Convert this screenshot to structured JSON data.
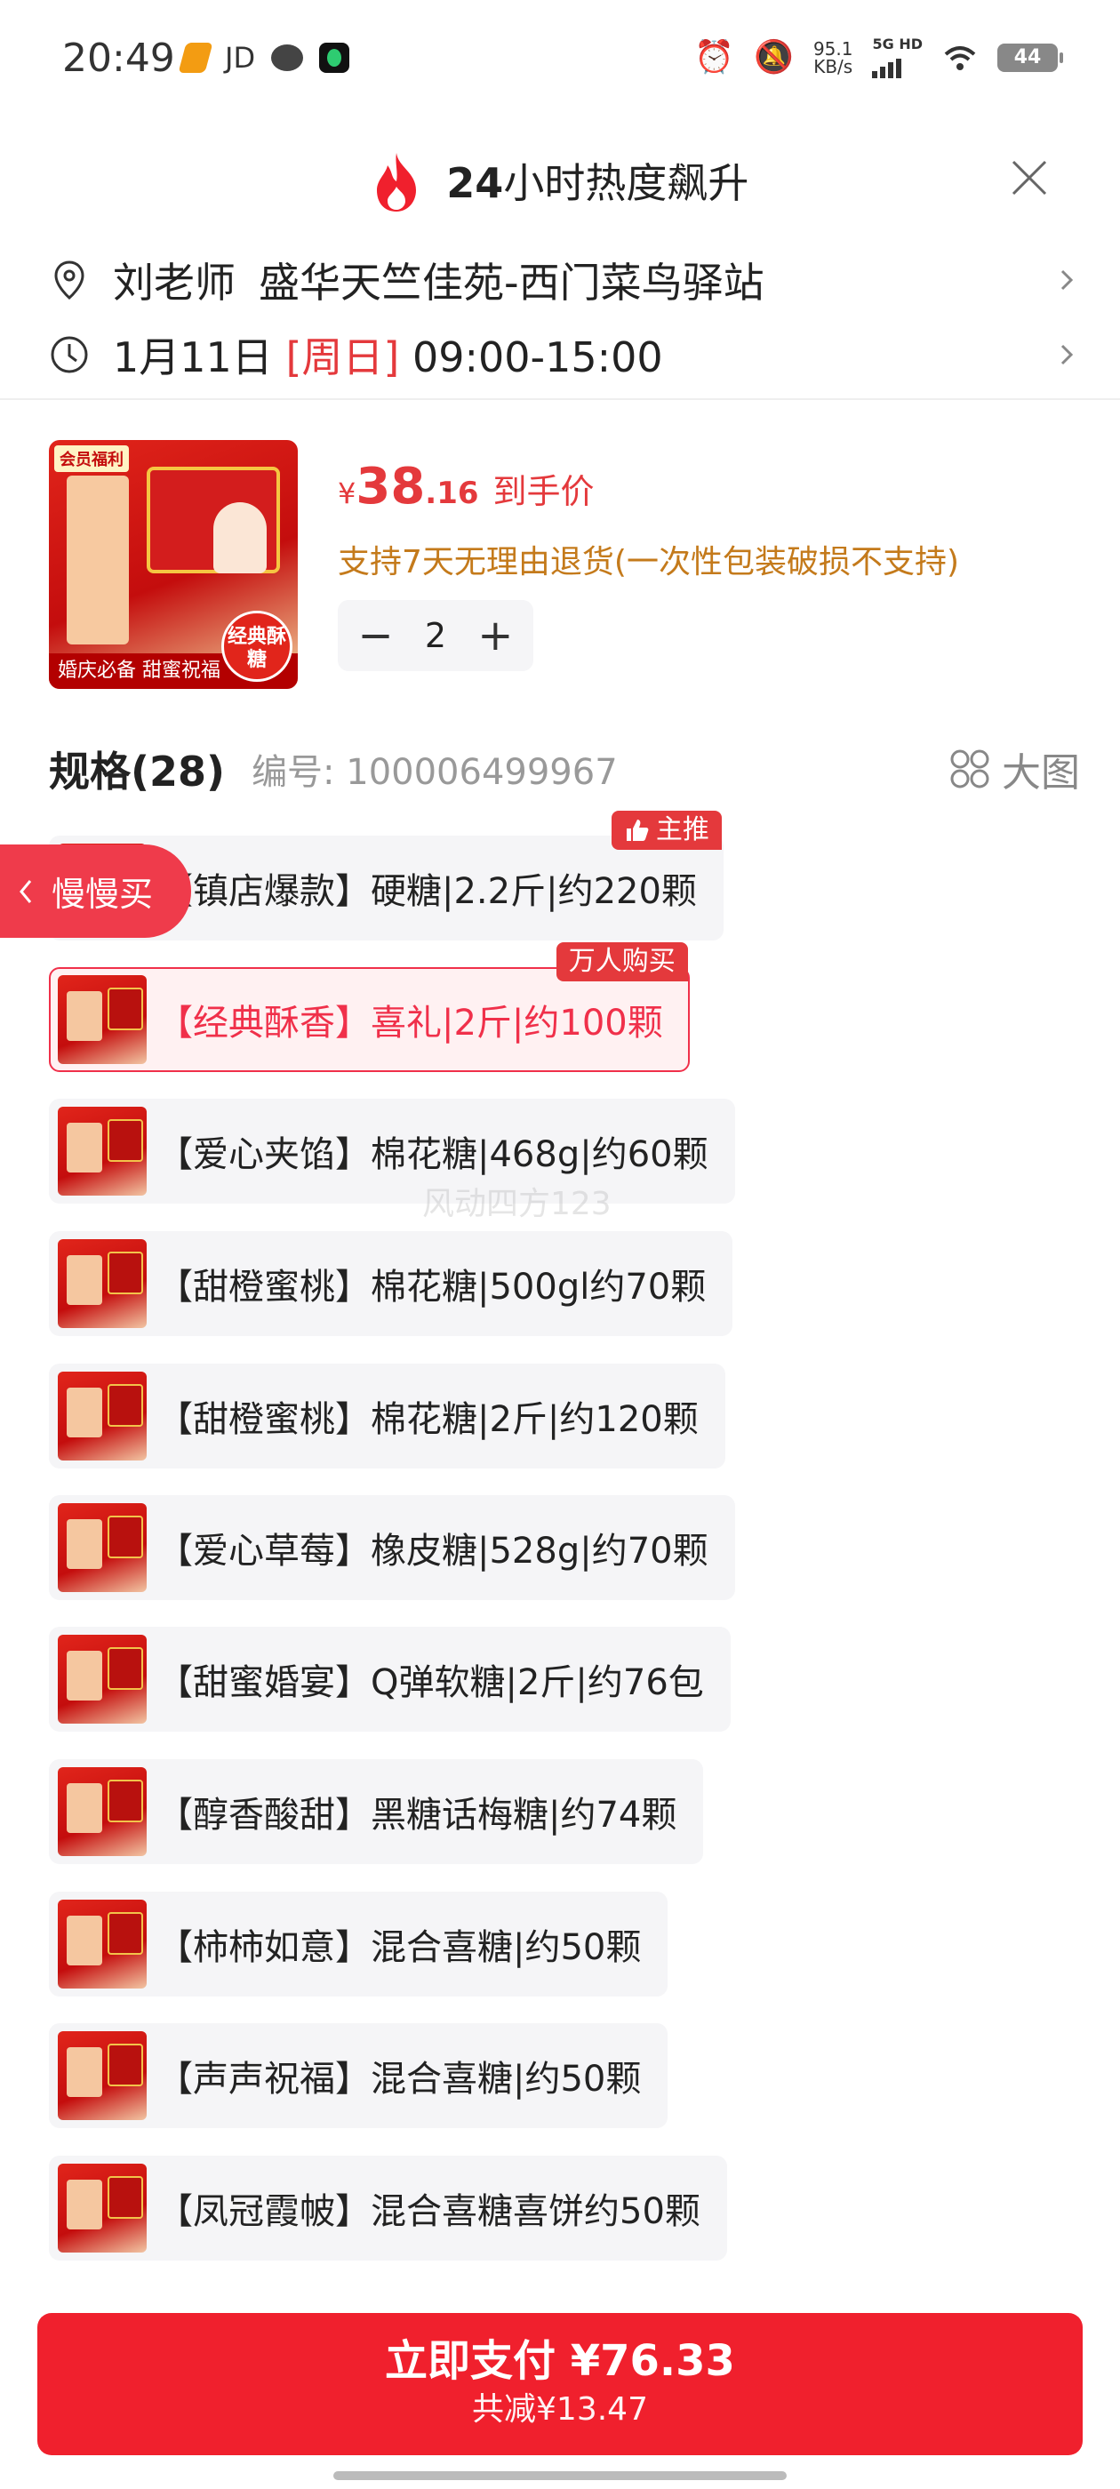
{
  "status_bar": {
    "time": "20:49",
    "jd_label": "JD",
    "speed_value": "95.1",
    "speed_unit": "KB/s",
    "network_label": "5G HD",
    "battery": "44"
  },
  "header": {
    "title_number": "24",
    "title_text": "小时热度飙升"
  },
  "delivery": {
    "recipient": "刘老师",
    "address": "盛华天竺佳苑-西门菜鸟驿站",
    "date": "1月11日",
    "weekday": "[周日]",
    "time_range": "09:00-15:00"
  },
  "product": {
    "price_symbol": "¥",
    "price_integer": "38",
    "price_decimal": ".16",
    "price_label": "到手价",
    "return_policy": "支持7天无理由退货(一次性包装破损不支持)",
    "quantity": "2",
    "image_top_tag": "会员福利",
    "image_bottom_tag": "婚庆必备 甜蜜祝福",
    "image_badge": "经典酥糖"
  },
  "spec": {
    "title": "规格(28)",
    "code_label": "编号: 100006499967",
    "big_pic_label": "大图",
    "slow_buy_label": "慢慢买",
    "watermark": "风动四方123",
    "items": [
      {
        "label": "【镇店爆款】硬糖|2.2斤|约220颗",
        "tag": "主推"
      },
      {
        "label": "【经典酥香】喜礼|2斤|约100颗",
        "tag": "万人购买"
      },
      {
        "label": "【爱心夹馅】棉花糖|468g|约60颗"
      },
      {
        "label": "【甜橙蜜桃】棉花糖|500gl约70颗"
      },
      {
        "label": "【甜橙蜜桃】棉花糖|2斤|约120颗"
      },
      {
        "label": "【爱心草莓】橡皮糖|528g|约70颗"
      },
      {
        "label": "【甜蜜婚宴】Q弹软糖|2斤|约76包"
      },
      {
        "label": "【醇香酸甜】黑糖话梅糖|约74颗"
      },
      {
        "label": "【柿柿如意】混合喜糖|约50颗"
      },
      {
        "label": "【声声祝福】混合喜糖|约50颗"
      },
      {
        "label": "【凤冠霞帔】混合喜糖喜饼约50颗"
      }
    ]
  },
  "pay": {
    "main_label": "立即支付 ¥76.33",
    "sub_label": "共减¥13.47"
  },
  "colors": {
    "accent_red": "#e4393c",
    "pay_red": "#f0202d",
    "policy_orange": "#c47a1b"
  }
}
